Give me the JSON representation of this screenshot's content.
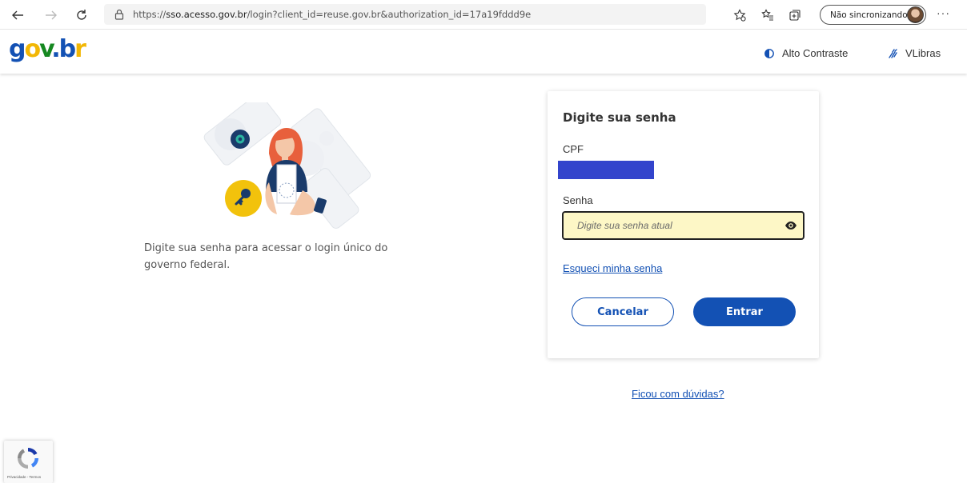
{
  "browser": {
    "url_scheme": "https://",
    "url_host": "sso.acesso.gov.br",
    "url_path": "/login?client_id=reuse.gov.br&authorization_id=17a19fddd9e",
    "profile_label": "Não sincronizando",
    "more_label": "···"
  },
  "header": {
    "logo": {
      "g": "g",
      "o": "o",
      "v": "v",
      "dot": ".",
      "b": "b",
      "r": "r"
    },
    "contrast_label": "Alto Contraste",
    "vlibras_label": "VLibras"
  },
  "intro": {
    "text": "Digite sua senha para acessar o login único do governo federal."
  },
  "login_card": {
    "title": "Digite sua senha",
    "cpf_label": "CPF",
    "senha_label": "Senha",
    "senha_placeholder": "Digite sua senha atual",
    "forgot_label": "Esqueci minha senha",
    "cancel_label": "Cancelar",
    "enter_label": "Entrar"
  },
  "help_label": "Ficou com dúvidas?",
  "recaptcha": {
    "text": "Privacidade - Termos"
  },
  "colors": {
    "brand_blue": "#1351b4",
    "brand_yellow": "#f2b705",
    "brand_green": "#168821",
    "input_highlight": "#fdf7c6",
    "redacted_cpf": "#3344cc"
  }
}
